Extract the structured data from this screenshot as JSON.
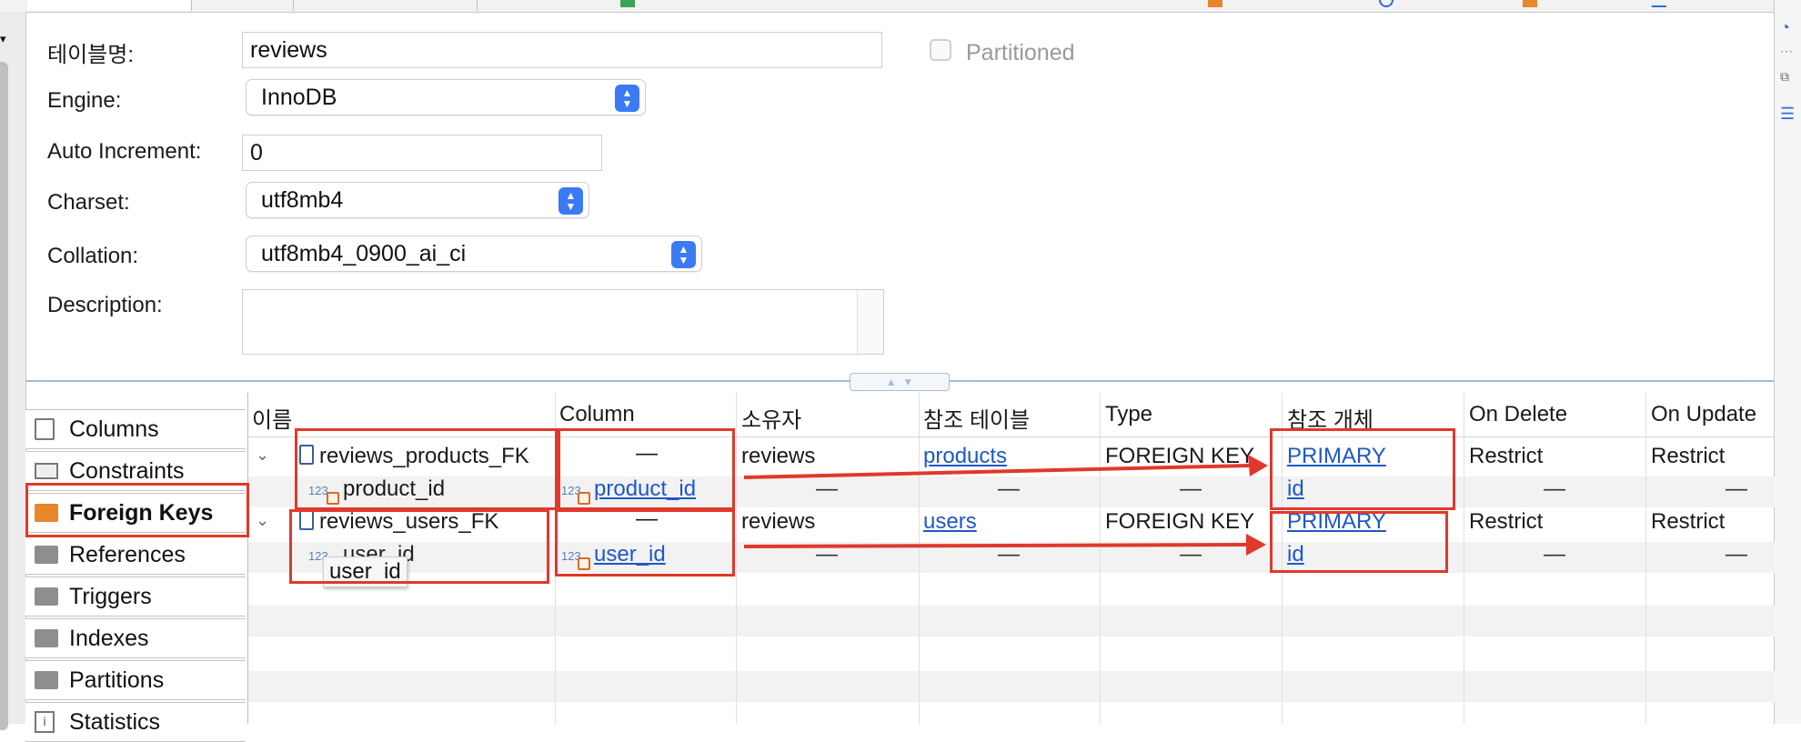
{
  "form": {
    "table_name_label": "테이블명:",
    "table_name_value": "reviews",
    "partitioned_label": "Partitioned",
    "engine_label": "Engine:",
    "engine_value": "InnoDB",
    "auto_increment_label": "Auto Increment:",
    "auto_increment_value": "0",
    "charset_label": "Charset:",
    "charset_value": "utf8mb4",
    "collation_label": "Collation:",
    "collation_value": "utf8mb4_0900_ai_ci",
    "description_label": "Description:",
    "description_value": ""
  },
  "nav": {
    "items": [
      {
        "label": "Columns",
        "icon": "columns-icon"
      },
      {
        "label": "Constraints",
        "icon": "constraints-icon"
      },
      {
        "label": "Foreign Keys",
        "icon": "folder-icon",
        "selected": true
      },
      {
        "label": "References",
        "icon": "folder-icon"
      },
      {
        "label": "Triggers",
        "icon": "folder-icon"
      },
      {
        "label": "Indexes",
        "icon": "folder-icon"
      },
      {
        "label": "Partitions",
        "icon": "folder-icon"
      },
      {
        "label": "Statistics",
        "icon": "info-icon"
      }
    ]
  },
  "grid": {
    "headers": [
      "이름",
      "Column",
      "소유자",
      "참조 테이블",
      "Type",
      "참조 개체",
      "On Delete",
      "On Update"
    ],
    "rows": [
      {
        "name": "reviews_products_FK",
        "column": "—",
        "owner": "reviews",
        "ref_table": "products",
        "type": "FOREIGN KEY",
        "ref_object": "PRIMARY",
        "on_delete": "Restrict",
        "on_update": "Restrict",
        "child": {
          "name": "product_id",
          "column": "product_id",
          "owner": "—",
          "ref_table": "—",
          "type": "—",
          "ref_object": "id",
          "on_delete": "—",
          "on_update": "—"
        }
      },
      {
        "name": "reviews_users_FK",
        "column": "—",
        "owner": "reviews",
        "ref_table": "users",
        "type": "FOREIGN KEY",
        "ref_object": "PRIMARY",
        "on_delete": "Restrict",
        "on_update": "Restrict",
        "child": {
          "name": "user_id",
          "column": "user_id",
          "owner": "—",
          "ref_table": "—",
          "type": "—",
          "ref_object": "id",
          "on_delete": "—",
          "on_update": "—"
        }
      }
    ],
    "type_tag": "123"
  },
  "tooltip": {
    "text": "user_id"
  },
  "colors": {
    "annotation": "#e0392b",
    "link": "#1f57c9",
    "accent": "#3a7bf5",
    "folder_selected": "#e8862a"
  }
}
